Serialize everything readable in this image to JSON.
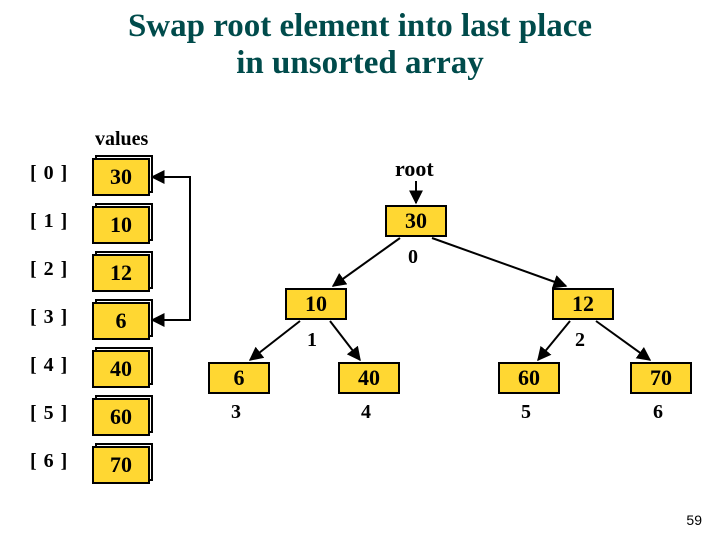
{
  "title_line1": "Swap root element into last place",
  "title_line2": "in unsorted array",
  "values_label": "values",
  "indices": [
    "[ 0 ]",
    "[ 1 ]",
    "[ 2 ]",
    "[ 3 ]",
    "[ 4 ]",
    "[ 5 ]",
    "[ 6 ]"
  ],
  "cells": [
    "30",
    "10",
    "12",
    "6",
    "40",
    "60",
    "70"
  ],
  "root_label": "root",
  "tree": {
    "root": "30",
    "root_index": "0",
    "l": "10",
    "l_idx": "1",
    "r": "12",
    "r_idx": "2",
    "ll": "6",
    "ll_idx": "3",
    "lr": "40",
    "lr_idx": "4",
    "rl": "60",
    "rl_idx": "5",
    "rr": "70",
    "rr_idx": "6"
  },
  "slide_number": "59",
  "chart_data": {
    "type": "diagram",
    "description": "Heap array and corresponding binary tree before swapping root with last unsorted element",
    "array": [
      30,
      10,
      12,
      6,
      40,
      60,
      70
    ],
    "tree_level_order": [
      30,
      10,
      12,
      6,
      40,
      60,
      70
    ],
    "swap_pair_indices": [
      0,
      3
    ]
  }
}
